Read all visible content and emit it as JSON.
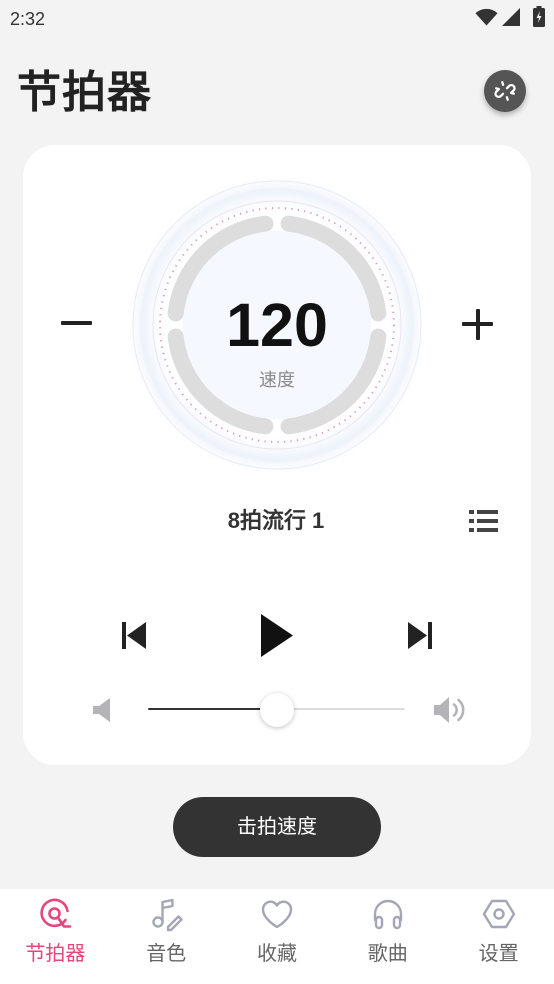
{
  "status_bar": {
    "time": "2:32",
    "icons": [
      "wifi-icon",
      "cell-signal-icon",
      "battery-charging-icon"
    ]
  },
  "header": {
    "title": "节拍器",
    "action_icon": "link-off-icon"
  },
  "metronome": {
    "tempo": "120",
    "tempo_label": "速度",
    "pattern_name": "8拍流行 1",
    "volume": 0.5,
    "controls": {
      "decrease_icon": "minus-icon",
      "increase_icon": "plus-icon",
      "pattern_list_icon": "list-icon",
      "previous_icon": "skip-previous-icon",
      "play_icon": "play-icon",
      "next_icon": "skip-next-icon",
      "volume_low_icon": "volume-mute-icon",
      "volume_high_icon": "volume-up-icon"
    }
  },
  "tap_tempo": {
    "label": "击拍速度"
  },
  "bottom_nav": {
    "items": [
      {
        "label": "节拍器",
        "icon": "metronome-icon",
        "active": true
      },
      {
        "label": "音色",
        "icon": "music-note-edit-icon",
        "active": false
      },
      {
        "label": "收藏",
        "icon": "heart-icon",
        "active": false
      },
      {
        "label": "歌曲",
        "icon": "headphones-icon",
        "active": false
      },
      {
        "label": "设置",
        "icon": "settings-hexagon-icon",
        "active": false
      }
    ]
  },
  "colors": {
    "background": "#f3f3f3",
    "card": "#ffffff",
    "accent": "#e8457d",
    "text_primary": "#222222",
    "text_secondary": "#8a8a8a",
    "ring": "#dddddd",
    "inactive_icon": "#a3a6b4",
    "button_dark": "#333333"
  }
}
